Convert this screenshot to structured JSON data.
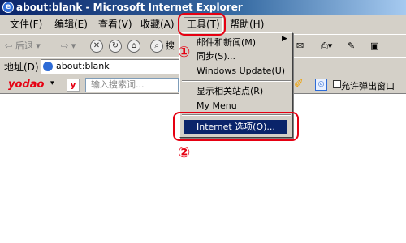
{
  "window": {
    "title": "about:blank - Microsoft Internet Explorer"
  },
  "menubar": {
    "items": [
      "文件(F)",
      "编辑(E)",
      "查看(V)",
      "收藏(A)",
      "工具(T)",
      "帮助(H)"
    ]
  },
  "toolbar": {
    "back": "后退",
    "search": "搜"
  },
  "addressbar": {
    "label": "地址(D)",
    "value": "about:blank"
  },
  "yodao": {
    "logo": "yodao",
    "search_placeholder": "输入搜索词...",
    "popup_label": "允许弹出窗口"
  },
  "dropdown": {
    "items": [
      "邮件和新闻(M)",
      "同步(S)...",
      "Windows Update(U)",
      "显示相关站点(R)",
      "My Menu",
      "Internet 选项(O)..."
    ]
  },
  "annotations": {
    "step1": "①",
    "step2": "②"
  },
  "colors": {
    "annotation": "#e60012",
    "highlight": "#0a246a",
    "chrome": "#d4d0c8"
  }
}
